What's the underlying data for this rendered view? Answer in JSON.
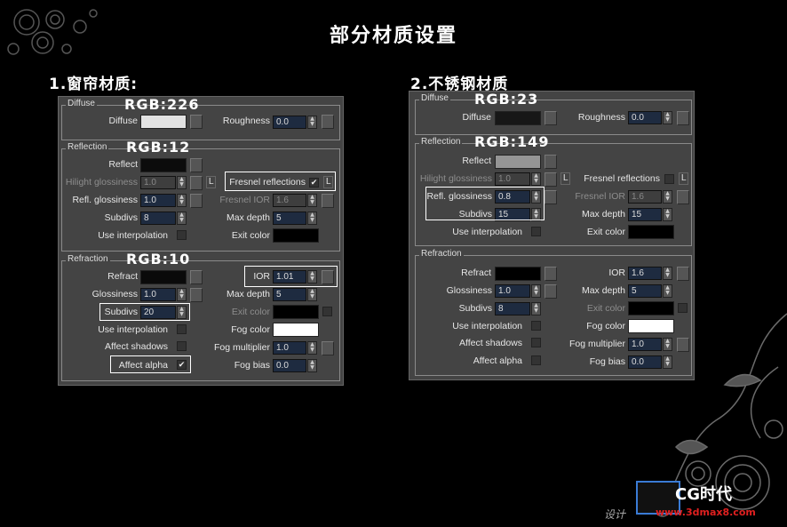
{
  "title": "部分材质设置",
  "section1": {
    "title": "1.窗帘材质:"
  },
  "section2": {
    "title": "2.不锈钢材质"
  },
  "labels": {
    "diffuse_group": "Diffuse",
    "diffuse": "Diffuse",
    "roughness": "Roughness",
    "reflection_group": "Reflection",
    "reflect": "Reflect",
    "hilight": "Hilight glossiness",
    "refl_gloss": "Refl. glossiness",
    "subdivs": "Subdivs",
    "use_interp": "Use interpolation",
    "fresnel": "Fresnel reflections",
    "fresnel_ior": "Fresnel IOR",
    "max_depth": "Max depth",
    "exit_color": "Exit color",
    "refraction_group": "Refraction",
    "refract": "Refract",
    "glossiness": "Glossiness",
    "ior": "IOR",
    "affect_shadows": "Affect shadows",
    "affect_alpha": "Affect alpha",
    "fog_color": "Fog color",
    "fog_mult": "Fog multiplier",
    "fog_bias": "Fog bias",
    "L": "L"
  },
  "panel1": {
    "rgb_diffuse": "RGB:226",
    "rgb_reflect": "RGB:12",
    "rgb_refract": "RGB:10",
    "roughness": "0.0",
    "hilight": "1.0",
    "refl_gloss": "1.0",
    "subdivs": "8",
    "fresnel_ior": "1.6",
    "max_depth": "5",
    "ior": "1.01",
    "glossiness": "1.0",
    "refr_subdivs": "20",
    "refr_max_depth": "5",
    "fog_mult": "1.0",
    "fog_bias": "0.0",
    "colors": {
      "diffuse": "#e2e2e2",
      "reflect": "#0c0c0c",
      "refract": "#0a0a0a",
      "exit": "#000000",
      "refr_exit": "#000000",
      "fog": "#ffffff"
    }
  },
  "panel2": {
    "rgb_diffuse": "RGB:23",
    "rgb_reflect": "RGB:149",
    "roughness": "0.0",
    "hilight": "1.0",
    "refl_gloss": "0.8",
    "subdivs": "15",
    "fresnel_ior": "1.6",
    "max_depth": "15",
    "ior": "1.6",
    "glossiness": "1.0",
    "refr_subdivs": "8",
    "refr_max_depth": "5",
    "fog_mult": "1.0",
    "fog_bias": "0.0",
    "colors": {
      "diffuse": "#171717",
      "reflect": "#959595",
      "refract": "#000000",
      "exit": "#000000",
      "refr_exit": "#000000",
      "fog": "#ffffff"
    }
  },
  "watermark": {
    "text": "CG时代",
    "url": "www.3dmax8.com",
    "tagline": "设计"
  }
}
